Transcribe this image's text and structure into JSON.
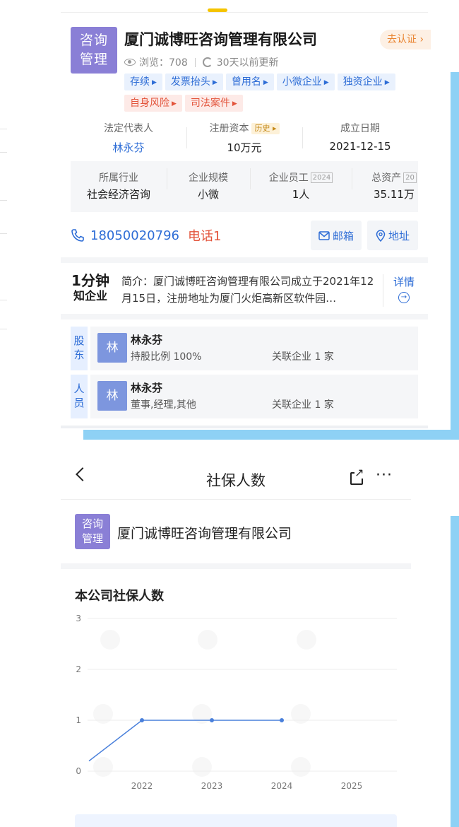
{
  "company": {
    "logo_line1": "咨询",
    "logo_line2": "管理",
    "name": "厦门诚博旺咨询管理有限公司",
    "verify_label": "去认证 ›",
    "views_label": "浏览：708",
    "updated_label": "30天以前更新"
  },
  "tags_row1": [
    "存续",
    "发票抬头",
    "曾用名",
    "小微企业",
    "独资企业"
  ],
  "tags_row2": [
    "自身风险",
    "司法案件"
  ],
  "info": {
    "legal_rep_label": "法定代表人",
    "legal_rep_value": "林永芬",
    "capital_label": "注册资本",
    "capital_history_badge": "历史",
    "capital_value": "10万元",
    "founded_label": "成立日期",
    "founded_value": "2021-12-15"
  },
  "info2": {
    "industry_label": "所属行业",
    "industry_value": "社会经济咨询",
    "scale_label": "企业规模",
    "scale_value": "小微",
    "staff_label": "企业员工",
    "staff_badge": "2024",
    "staff_value": "1人",
    "assets_label": "总资产",
    "assets_badge": "20",
    "assets_value": "35.11万"
  },
  "contact": {
    "phone": "18050020796",
    "phone_more": "电话1",
    "email_label": "邮箱",
    "address_label": "地址"
  },
  "intro": {
    "logo_line1": "1分钟",
    "logo_line2": "知企业",
    "text": "简介：厦门诚博旺咨询管理有限公司成立于2021年12月15日，注册地址为厦门火炬高新区软件园…",
    "more_label": "详情"
  },
  "shareholders": {
    "side_label_1": "股",
    "side_label_2": "东",
    "avatar": "林",
    "name": "林永芬",
    "detail": "持股比例 100%",
    "related": "关联企业 1 家"
  },
  "staff": {
    "side_label_1": "人",
    "side_label_2": "员",
    "avatar": "林",
    "name": "林永芬",
    "detail": "董事,经理,其他",
    "related": "关联企业 1 家"
  },
  "page2": {
    "title": "社保人数",
    "company_logo_line1": "咨询",
    "company_logo_line2": "管理",
    "company_name": "厦门诚博旺咨询管理有限公司",
    "chart_heading": "本公司社保人数"
  },
  "chart_data": {
    "type": "line",
    "title": "本公司社保人数",
    "categories": [
      "2022",
      "2023",
      "2024",
      "2025"
    ],
    "x": [
      "2021",
      "2022",
      "2023",
      "2024"
    ],
    "values": [
      0.2,
      1,
      1,
      1
    ],
    "yticks": [
      0,
      1,
      2,
      3
    ],
    "ylim": [
      0,
      3
    ],
    "grid": true,
    "color": "#4a80db"
  }
}
